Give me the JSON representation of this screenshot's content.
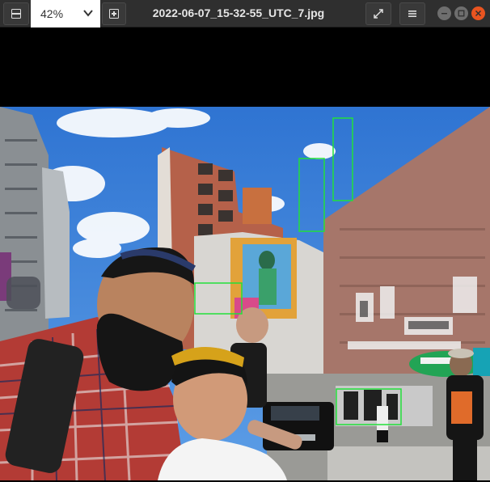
{
  "window": {
    "zoom_value": "42%",
    "filename": "2022-06-07_15-32-55_UTC_7.jpg"
  },
  "icons": {
    "zoom_out": "minus-icon",
    "zoom_dropdown": "chevron-down-icon",
    "zoom_in": "plus-icon",
    "fullscreen": "expand-icon",
    "menu": "hamburger-icon",
    "minimize": "minimize-icon",
    "maximize": "maximize-icon",
    "close": "close-icon"
  },
  "colors": {
    "titlebar": "#2f2f2f",
    "close_button": "#e95420",
    "window_button": "#6e6e6e",
    "detection_box": "#22e03a"
  },
  "detections_count": 5
}
